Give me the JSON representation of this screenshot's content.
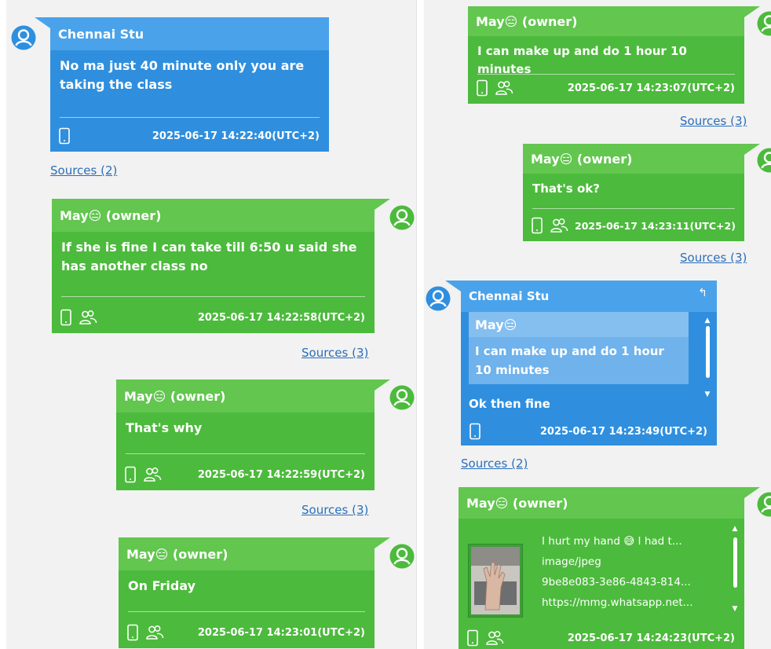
{
  "colors": {
    "green": "#4cba3c",
    "green_header": "#62c64f",
    "blue": "#2f8fde",
    "blue_header": "#4aa3ea",
    "link": "#2a6ebb"
  },
  "left": {
    "messages": [
      {
        "sender": "Chennai Stu",
        "text": "No ma just 40 minute only you are taking the class",
        "timestamp": "2025-06-17 14:22:40(UTC+2)",
        "sources": "Sources (2)",
        "icons": [
          "phone-icon"
        ]
      },
      {
        "sender": "May😑 (owner)",
        "text": "If she is fine I can take till 6:50 u said she has another class no",
        "timestamp": "2025-06-17 14:22:58(UTC+2)",
        "sources": "Sources (3)",
        "icons": [
          "phone-icon",
          "group-icon"
        ]
      },
      {
        "sender": "May😑 (owner)",
        "text": "That's why",
        "timestamp": "2025-06-17 14:22:59(UTC+2)",
        "sources": "Sources (3)",
        "icons": [
          "phone-icon",
          "group-icon"
        ]
      },
      {
        "sender": "May😑 (owner)",
        "text": "On Friday",
        "timestamp": "2025-06-17 14:23:01(UTC+2)",
        "icons": [
          "phone-icon",
          "group-icon"
        ]
      }
    ]
  },
  "right": {
    "messages": [
      {
        "sender": "May😑 (owner)",
        "text": "I can make up and do 1 hour 10 minutes",
        "timestamp": "2025-06-17 14:23:07(UTC+2)",
        "sources": "Sources (3)",
        "icons": [
          "phone-icon",
          "group-icon"
        ]
      },
      {
        "sender": "May😑 (owner)",
        "text": "That's ok?",
        "timestamp": "2025-06-17 14:23:11(UTC+2)",
        "sources": "Sources (3)",
        "icons": [
          "phone-icon",
          "group-icon"
        ]
      },
      {
        "sender": "Chennai Stu",
        "quote": {
          "sender": "May😑",
          "text": "I can make up and do 1 hour 10 minutes"
        },
        "text": "Ok then fine",
        "timestamp": "2025-06-17 14:23:49(UTC+2)",
        "sources": "Sources (2)",
        "icons": [
          "phone-icon"
        ],
        "reply_icon": "reply-icon"
      },
      {
        "sender": "May😑 (owner)",
        "media": {
          "caption": "I hurt my hand 😅 I had t...",
          "mime": "image/jpeg",
          "id": "9be8e083-3e86-4843-814...",
          "url": "https://mmg.whatsapp.net..."
        },
        "timestamp": "2025-06-17 14:24:23(UTC+2)",
        "icons": [
          "phone-icon",
          "group-icon"
        ]
      }
    ]
  }
}
